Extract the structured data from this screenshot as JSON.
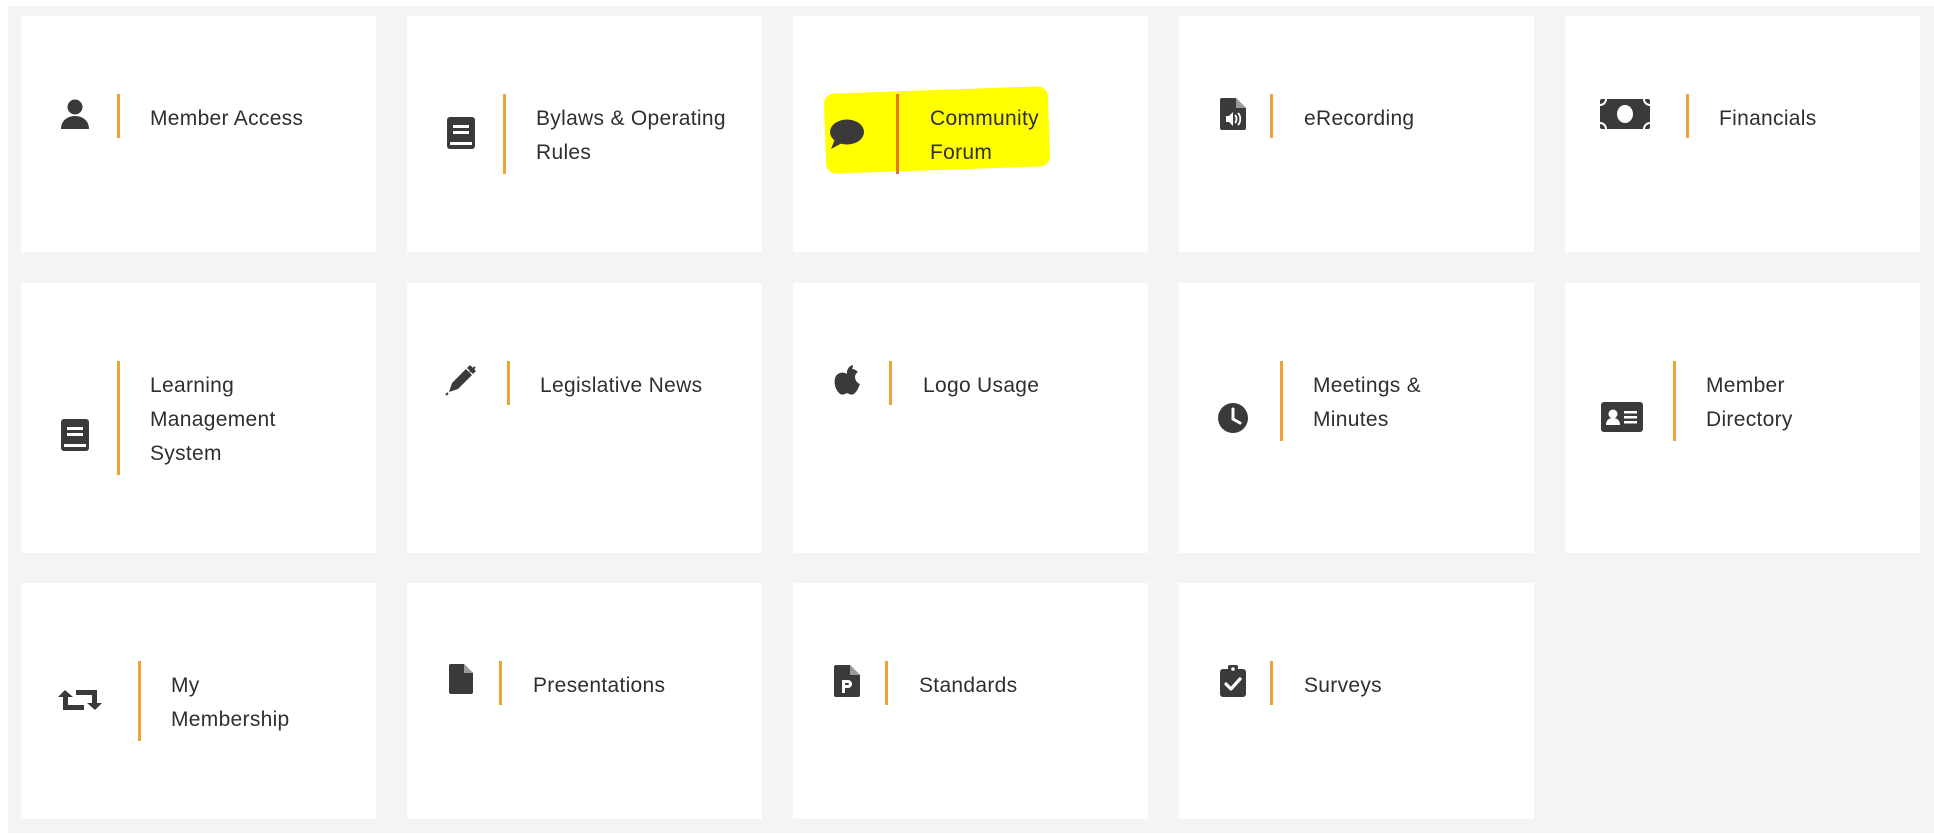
{
  "colors": {
    "accent_bar": "#f0a236",
    "tile_background": "#ffffff",
    "panel_background": "#f4f4f4",
    "text": "#2f2f2f",
    "icon": "#3a3a3a",
    "highlight": "#ffff00"
  },
  "tiles": [
    {
      "id": "member-access",
      "icon": "user-icon",
      "label": "Member Access"
    },
    {
      "id": "bylaws",
      "icon": "book-icon",
      "label": "Bylaws & Operating Rules"
    },
    {
      "id": "community-forum",
      "icon": "comment-icon",
      "label": "Community Forum",
      "highlighted": true
    },
    {
      "id": "erecording",
      "icon": "file-audio-icon",
      "label": "eRecording"
    },
    {
      "id": "financials",
      "icon": "money-bill-icon",
      "label": "Financials"
    },
    {
      "id": "lms",
      "icon": "book-icon",
      "label": "Learning Management System"
    },
    {
      "id": "legislative-news",
      "icon": "pen-icon",
      "label": "Legislative News"
    },
    {
      "id": "logo-usage",
      "icon": "apple-icon",
      "label": "Logo Usage"
    },
    {
      "id": "meetings-minutes",
      "icon": "clock-icon",
      "label": "Meetings & Minutes"
    },
    {
      "id": "member-directory",
      "icon": "id-card-icon",
      "label": "Member Directory"
    },
    {
      "id": "my-membership",
      "icon": "retweet-icon",
      "label": "My Membership"
    },
    {
      "id": "presentations",
      "icon": "file-icon",
      "label": "Presentations"
    },
    {
      "id": "standards",
      "icon": "file-p-icon",
      "label": "Standards"
    },
    {
      "id": "surveys",
      "icon": "clipboard-check-icon",
      "label": "Surveys"
    }
  ]
}
